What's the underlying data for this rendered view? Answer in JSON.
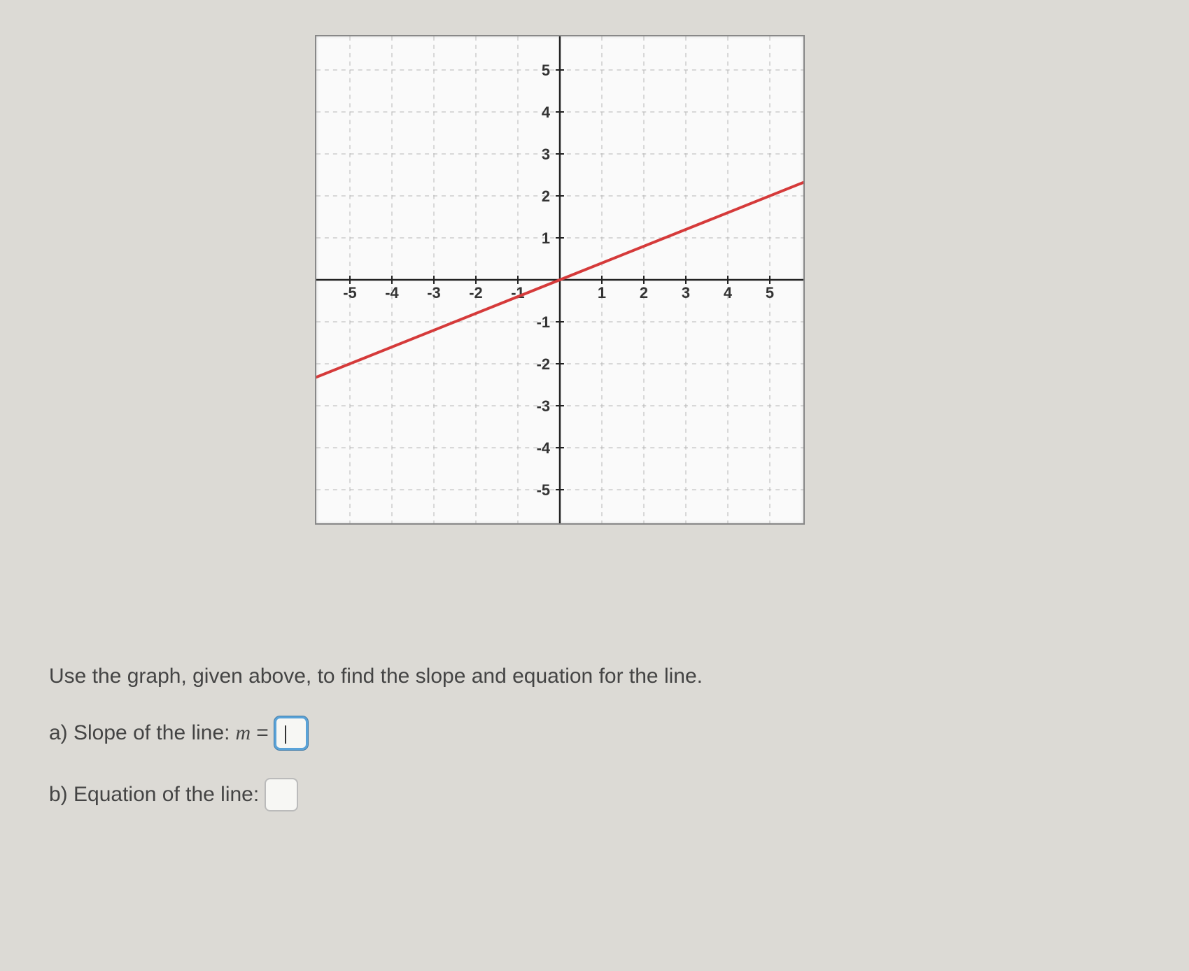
{
  "chart_data": {
    "type": "line",
    "xlim": [
      -5.8,
      5.8
    ],
    "ylim": [
      -5.8,
      5.8
    ],
    "x_ticks": [
      -5,
      -4,
      -3,
      -2,
      -1,
      1,
      2,
      3,
      4,
      5
    ],
    "y_ticks": [
      5,
      4,
      3,
      2,
      1,
      -1,
      -2,
      -3,
      -4,
      -5
    ],
    "grid": true,
    "series": [
      {
        "name": "line",
        "color": "#d53a3a",
        "points": [
          [
            -5.8,
            -2.32
          ],
          [
            5.8,
            2.32
          ]
        ]
      }
    ],
    "slope": 0.4,
    "intercept": 0
  },
  "question": {
    "prompt": "Use the graph, given above, to find the slope and equation for the line.",
    "part_a_label": "a) Slope of the line:",
    "part_a_var": "m",
    "equals": "=",
    "part_b_label": "b) Equation of the line:"
  }
}
